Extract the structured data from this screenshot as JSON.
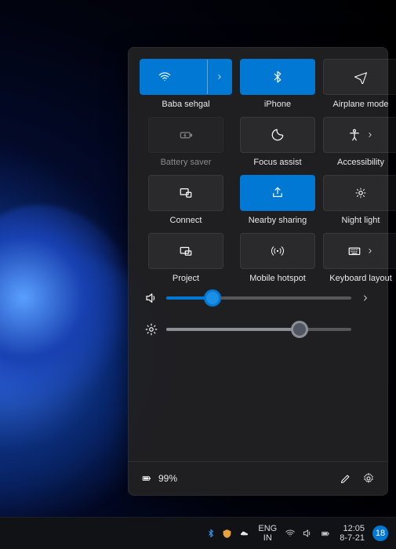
{
  "tiles": [
    {
      "name": "wifi",
      "label": "Baba sehgal",
      "active": true,
      "split": true,
      "disabled": false
    },
    {
      "name": "bluetooth",
      "label": "iPhone",
      "active": true,
      "split": false,
      "disabled": false
    },
    {
      "name": "airplane",
      "label": "Airplane mode",
      "active": false,
      "split": false,
      "disabled": false
    },
    {
      "name": "battery-saver",
      "label": "Battery saver",
      "active": false,
      "split": false,
      "disabled": true
    },
    {
      "name": "focus-assist",
      "label": "Focus assist",
      "active": false,
      "split": false,
      "disabled": false
    },
    {
      "name": "accessibility",
      "label": "Accessibility",
      "active": false,
      "split": true,
      "disabled": false,
      "innerChevron": true
    },
    {
      "name": "connect",
      "label": "Connect",
      "active": false,
      "split": false,
      "disabled": false
    },
    {
      "name": "nearby-sharing",
      "label": "Nearby sharing",
      "active": true,
      "split": false,
      "disabled": false
    },
    {
      "name": "night-light",
      "label": "Night light",
      "active": false,
      "split": false,
      "disabled": false
    },
    {
      "name": "project",
      "label": "Project",
      "active": false,
      "split": false,
      "disabled": false
    },
    {
      "name": "mobile-hotspot",
      "label": "Mobile hotspot",
      "active": false,
      "split": false,
      "disabled": false
    },
    {
      "name": "keyboard-layout",
      "label": "Keyboard layout",
      "active": false,
      "split": false,
      "disabled": false,
      "innerChevron": true
    }
  ],
  "sliders": {
    "volume": {
      "value": 25,
      "color": "#0078d4",
      "thumbColor": "#1a8fe3"
    },
    "brightness": {
      "value": 72,
      "color": "#8a8f98",
      "thumbColor": "#515661"
    }
  },
  "footer": {
    "battery_text": "99%"
  },
  "taskbar": {
    "lang_top": "ENG",
    "lang_bot": "IN",
    "time": "12:05",
    "date": "8-7-21",
    "notif_count": "18"
  }
}
